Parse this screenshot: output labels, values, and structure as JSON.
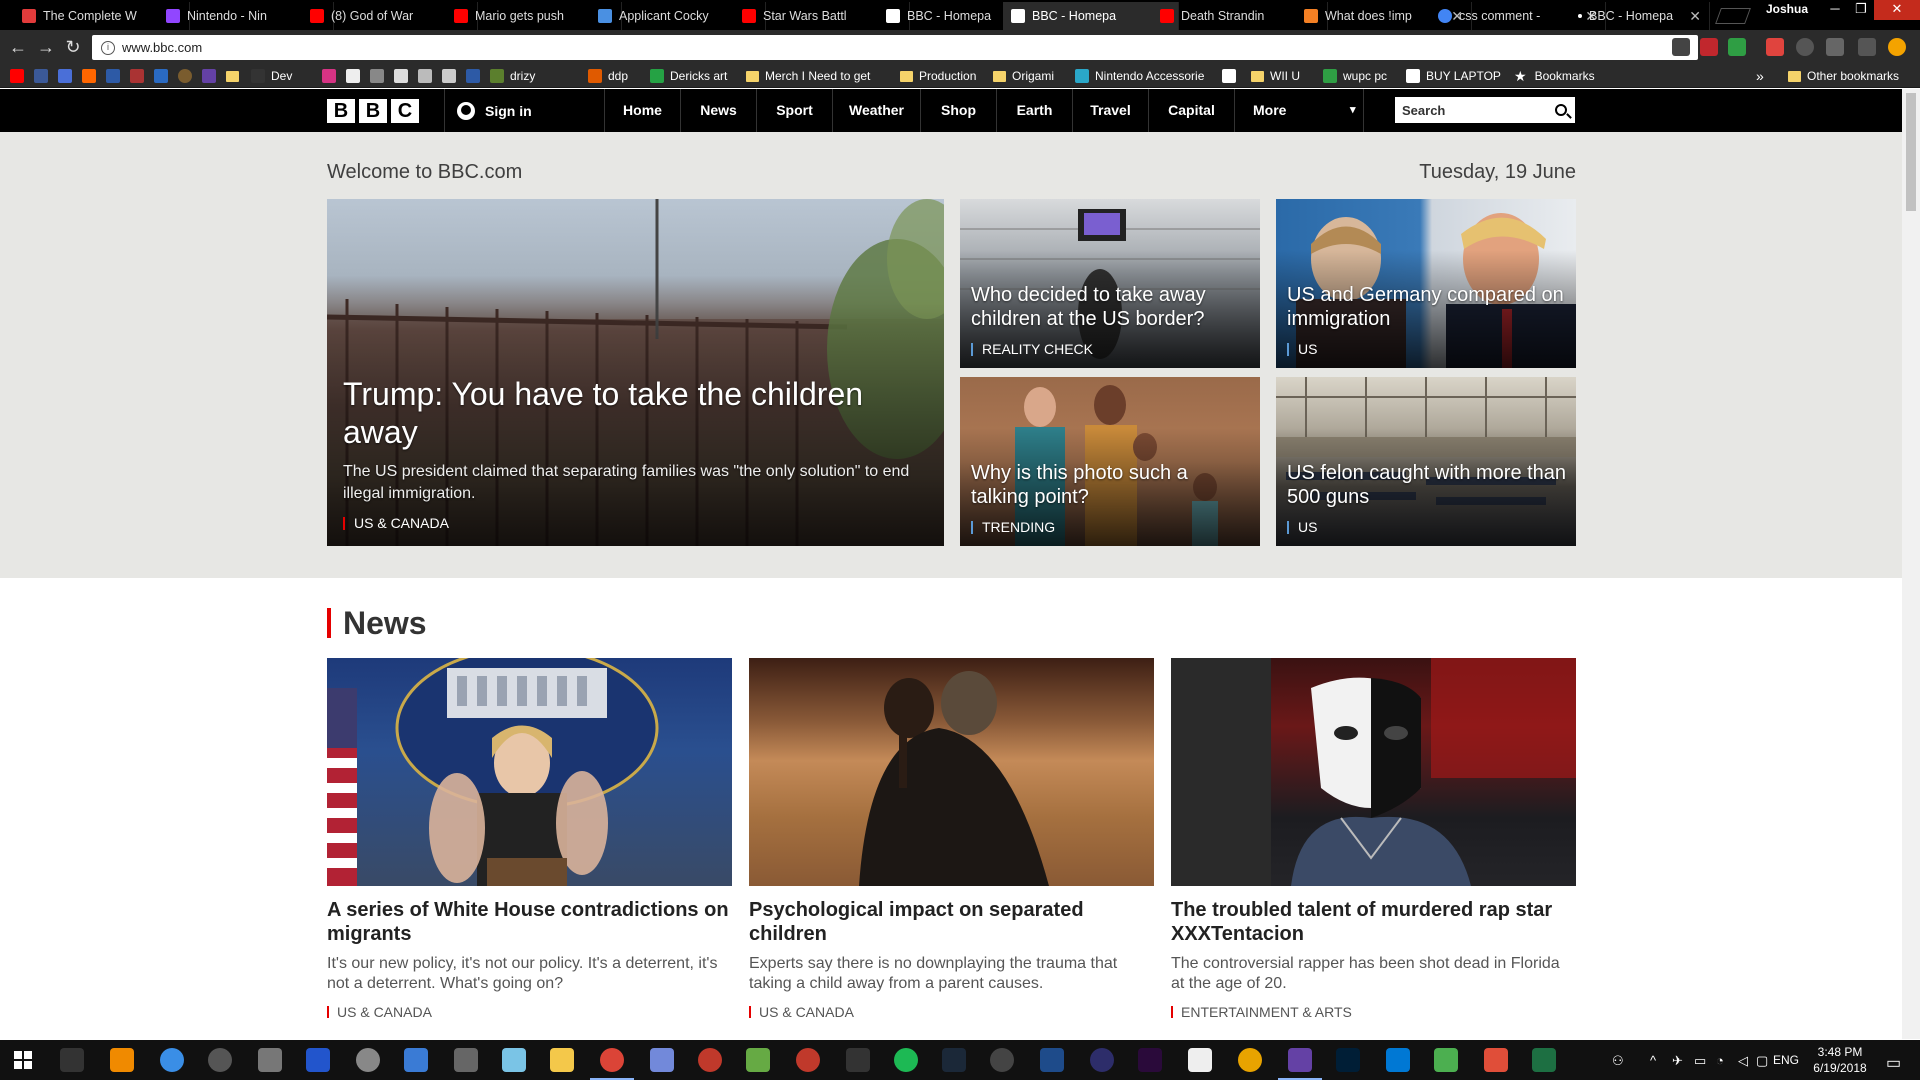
{
  "browser": {
    "tabs": [
      {
        "title": "The Complete W",
        "color": "#e23b3b"
      },
      {
        "title": "Nintendo - Nin",
        "color": "#9146ff"
      },
      {
        "title": "(8) God of War",
        "color": "#ff0000"
      },
      {
        "title": "Mario gets push",
        "color": "#ff0000"
      },
      {
        "title": "Applicant Cocky",
        "color": "#4a90e2"
      },
      {
        "title": "Star Wars Battl",
        "color": "#ff0000"
      },
      {
        "title": "BBC - Homepa",
        "color": "#ffffff"
      },
      {
        "title": "BBC - Homepa",
        "color": "#ffffff",
        "active": true
      },
      {
        "title": "Death Strandin",
        "color": "#ff0000"
      },
      {
        "title": "What does !imp",
        "color": "#f48024"
      },
      {
        "title": "css comment -",
        "color": "#4285f4"
      },
      {
        "title": "BBC - Homepa",
        "color": "#ffffff"
      }
    ],
    "profile_name": "Joshua",
    "url": "www.bbc.com",
    "bookmarks": [
      {
        "label": "Dev",
        "type": "folder"
      },
      {
        "label": "drizy",
        "type": "link"
      },
      {
        "label": "ddp",
        "type": "link"
      },
      {
        "label": "Dericks art",
        "type": "link"
      },
      {
        "label": "Merch I Need to get",
        "type": "folder"
      },
      {
        "label": "Production",
        "type": "folder"
      },
      {
        "label": "Origami",
        "type": "folder"
      },
      {
        "label": "Nintendo Accessorie",
        "type": "link"
      },
      {
        "label": "WII U",
        "type": "folder"
      },
      {
        "label": "wupc pc",
        "type": "link"
      },
      {
        "label": "BUY LAPTOP",
        "type": "link"
      },
      {
        "label": "Bookmarks",
        "type": "link"
      }
    ],
    "other_bookmarks": "Other bookmarks",
    "overflow": "»"
  },
  "bbc": {
    "logo_letters": [
      "B",
      "B",
      "C"
    ],
    "sign_in": "Sign in",
    "nav": [
      "Home",
      "News",
      "Sport",
      "Weather",
      "Shop",
      "Earth",
      "Travel",
      "Capital",
      "More"
    ],
    "more_arrow": "▾",
    "search_placeholder": "Search",
    "welcome": "Welcome to BBC.com",
    "date": "Tuesday, 19 June",
    "hero": {
      "main": {
        "title": "Trump: You have to take the children away",
        "summary": "The US president claimed that separating families was \"the only solution\" to end illegal immigration.",
        "tag": "US & CANADA"
      },
      "cards": [
        {
          "title": "Who decided to take away children at the US border?",
          "tag": "REALITY CHECK"
        },
        {
          "title": "US and Germany compared on immigration",
          "tag": "US"
        },
        {
          "title": "Why is this photo such a talking point?",
          "tag": "TRENDING"
        },
        {
          "title": "US felon caught with more than 500 guns",
          "tag": "US"
        }
      ]
    },
    "news_section": {
      "heading": "News",
      "stories": [
        {
          "title": "A series of White House contradictions on migrants",
          "summary": "It's our new policy, it's not our policy. It's a deterrent, it's not a deterrent. What's going on?",
          "tag": "US & CANADA"
        },
        {
          "title": "Psychological impact on separated children",
          "summary": "Experts say there is no downplaying the trauma that taking a child away from a parent causes.",
          "tag": "US & CANADA"
        },
        {
          "title": "The troubled talent of murdered rap star XXXTentacion",
          "summary": "The controversial rapper has been shot dead in Florida at the age of 20.",
          "tag": "ENTERTAINMENT & ARTS"
        }
      ]
    }
  },
  "taskbar": {
    "language": "ENG",
    "time": "3:48 PM",
    "date": "6/19/2018"
  }
}
